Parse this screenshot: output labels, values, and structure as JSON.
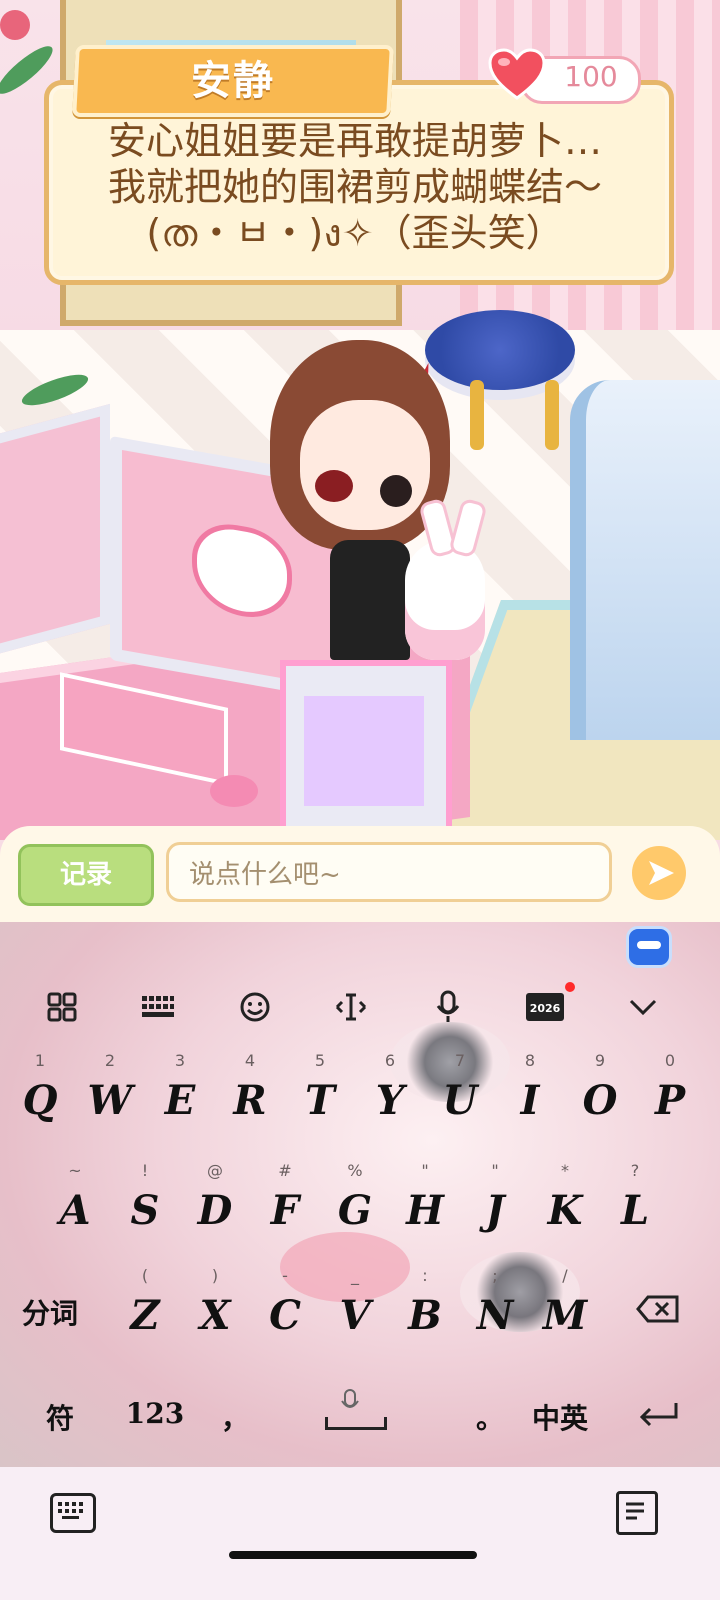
{
  "dialog": {
    "speaker": "安静",
    "affection": "100",
    "lines": [
      "安心姐姐要是再敢提胡萝卜…",
      "我就把她的围裙剪成蝴蝶结～",
      "(ത・ㅂ・)ง✧（歪头笑）"
    ]
  },
  "input_bar": {
    "record_label": "记录",
    "placeholder": "说点什么吧~"
  },
  "keyboard": {
    "toolbar": [
      "grid-icon",
      "keyboard-layout-icon",
      "emoji-icon",
      "cursor-icon",
      "mic-icon",
      "2026",
      "collapse-icon"
    ],
    "rows": [
      [
        {
          "k": "Q",
          "h": "1"
        },
        {
          "k": "W",
          "h": "2"
        },
        {
          "k": "E",
          "h": "3"
        },
        {
          "k": "R",
          "h": "4"
        },
        {
          "k": "T",
          "h": "5"
        },
        {
          "k": "Y",
          "h": "6"
        },
        {
          "k": "U",
          "h": "7"
        },
        {
          "k": "I",
          "h": "8"
        },
        {
          "k": "O",
          "h": "9"
        },
        {
          "k": "P",
          "h": "0"
        }
      ],
      [
        {
          "k": "A",
          "h": "~"
        },
        {
          "k": "S",
          "h": "!"
        },
        {
          "k": "D",
          "h": "@"
        },
        {
          "k": "F",
          "h": "#"
        },
        {
          "k": "G",
          "h": "%"
        },
        {
          "k": "H",
          "h": "\""
        },
        {
          "k": "J",
          "h": "\""
        },
        {
          "k": "K",
          "h": "*"
        },
        {
          "k": "L",
          "h": "?"
        }
      ],
      [
        {
          "k": "分词",
          "h": ""
        },
        {
          "k": "Z",
          "h": "("
        },
        {
          "k": "X",
          "h": ")"
        },
        {
          "k": "C",
          "h": "-"
        },
        {
          "k": "V",
          "h": "_"
        },
        {
          "k": "B",
          "h": ":"
        },
        {
          "k": "N",
          "h": ";"
        },
        {
          "k": "M",
          "h": "/"
        }
      ],
      [
        {
          "k": "符",
          "h": ""
        },
        {
          "k": "123",
          "h": ""
        },
        {
          "k": "，",
          "h": ""
        },
        {
          "k": "",
          "h": ""
        },
        {
          "k": "。",
          "h": ""
        },
        {
          "k": "中英",
          "h": ""
        }
      ]
    ]
  },
  "colors": {
    "dialog_bg": "#fff4d8",
    "name_tag": "#f9b850",
    "record_btn": "#b9de7e",
    "send_btn": "#ffc96b"
  }
}
